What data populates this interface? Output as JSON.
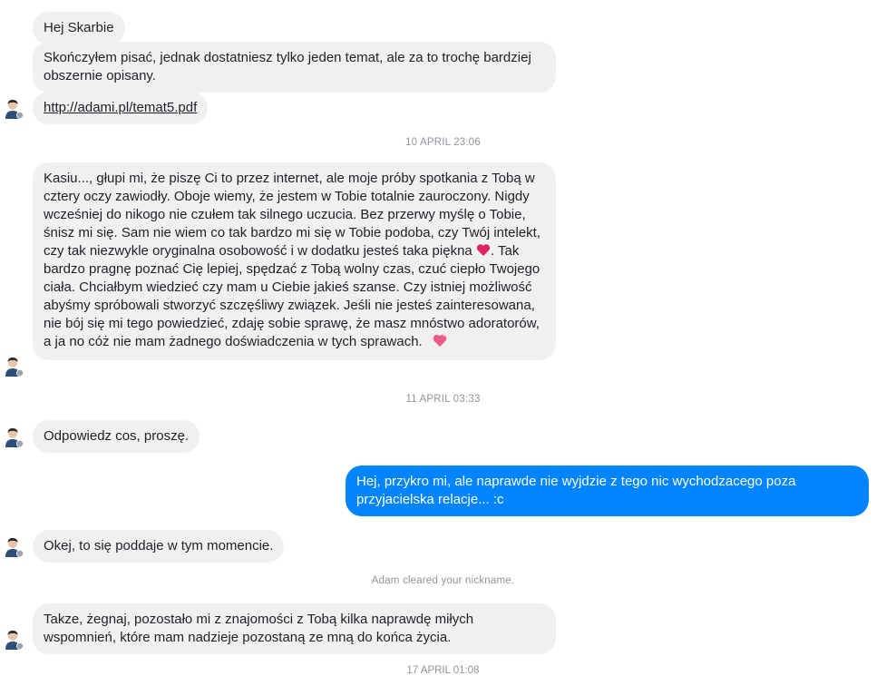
{
  "messages": {
    "m1": "Hej Skarbie",
    "m2": "Skończyłem pisać, jednak dostatniesz tylko jeden temat, ale za to trochę bardziej obszernie opisany.",
    "m3_link": "http://adami.pl/temat5.pdf",
    "ts1": "10 APRIL 23:06",
    "m4": "Kasiu..., głupi mi, że piszę Ci to przez internet, ale moje próby spotkania z Tobą w cztery oczy zawiodły. Oboje wiemy, że jestem w Tobie totalnie zauroczony. Nigdy wcześniej do nikogo nie czułem tak silnego uczucia. Bez przerwy myślę o Tobie, śnisz mi się. Sam nie wiem co tak bardzo mi się w Tobie podoba, czy Twój intelekt, czy tak niezwykle oryginalna osobowość i w dodatku jesteś taka piękna",
    "m4b": ". Tak bardzo pragnę poznać Cię lepiej, spędzać z Tobą wolny czas, czuć ciepło Twojego ciała. Chciałbym wiedzieć czy mam u Ciebie jakieś szanse. Czy istniej możliwość abyśmy spróbowali stworzyć szczęśliwy związek. Jeśli nie jesteś zainteresowana, nie bój się mi tego powiedzieć, zdaję sobie sprawę, że masz mnóstwo adoratorów, a ja no cóż nie mam żadnego doświadczenia w tych sprawach.",
    "ts2": "11 APRIL 03:33",
    "m5": "Odpowiedz cos, proszę.",
    "m6_out": "Hej, przykro mi, ale naprawde nie wyjdzie z tego nic wychodzacego poza przyjacielska relacje... :c",
    "m7": "Okej, to się poddaje w tym momencie.",
    "sys1": "Adam cleared your nickname.",
    "m8": "Takze, żegnaj, pozostało mi z znajomości z Tobą kilka naprawdę miłych wspomnień, które mam nadzieje pozostaną ze mną do końca życia.",
    "ts3": "17 APRIL 01:08"
  },
  "colors": {
    "incoming_bg": "#f1f0f0",
    "outgoing_bg": "#0084ff",
    "timestamp": "#90949c",
    "heart": "#e0245e"
  },
  "icons": {
    "avatar": "user-avatar-icon",
    "heart": "heart-icon",
    "sparkle_heart": "sparkling-heart-icon",
    "messenger_badge": "messenger-badge-icon"
  }
}
